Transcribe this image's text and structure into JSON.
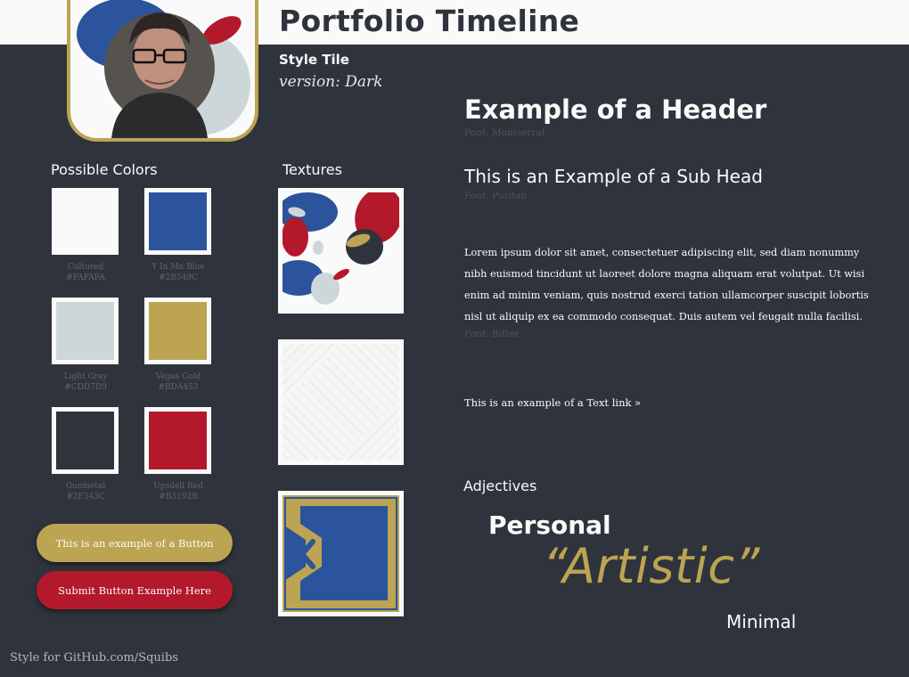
{
  "page": {
    "title": "Portfolio Timeline",
    "subtitle": "Style Tile",
    "version": "version: Dark",
    "footer": "Style for GitHub.com/Squibs"
  },
  "colors_section": {
    "label": "Possible Colors",
    "swatches": [
      {
        "name": "Cultured",
        "hex": "#FAFAFA"
      },
      {
        "name": "Y In Mn Blue",
        "hex": "#2B549C"
      },
      {
        "name": "Light Gray",
        "hex": "#CDD7D9"
      },
      {
        "name": "Vegas Gold",
        "hex": "#BDA453"
      },
      {
        "name": "Gunmetal",
        "hex": "#2F343C"
      },
      {
        "name": "Upsdell Red",
        "hex": "#B3192B"
      }
    ]
  },
  "textures_section": {
    "label": "Textures"
  },
  "buttons": {
    "primary_label": "This is an example of a Button",
    "submit_label": "Submit Button Example Here"
  },
  "typography": {
    "header": "Example of a Header",
    "header_font": "Font: Montserrat",
    "subhead": "This is an Example of a Sub Head",
    "subhead_font": "Font: Puritan",
    "body": "Lorem ipsum dolor sit amet, consectetuer adipiscing elit, sed diam nonummy nibh euismod tincidunt ut laoreet dolore magna aliquam erat volutpat. Ut wisi enim ad minim veniam, quis nostrud exerci tation ullamcorper suscipit lobortis nisl ut aliquip ex ea commodo consequat. Duis autem vel feugait nulla facilisi.",
    "body_font": "Font: Bitter",
    "link": "This is an example of a Text link »"
  },
  "adjectives": {
    "label": "Adjectives",
    "items": [
      "Personal",
      "“Artistic”",
      "Minimal"
    ]
  },
  "theme": {
    "background": "#2F343C",
    "accent": "#BDA453",
    "blue": "#2B549C",
    "red": "#B3192B",
    "light": "#FAFAFA",
    "gray": "#CDD7D9"
  }
}
